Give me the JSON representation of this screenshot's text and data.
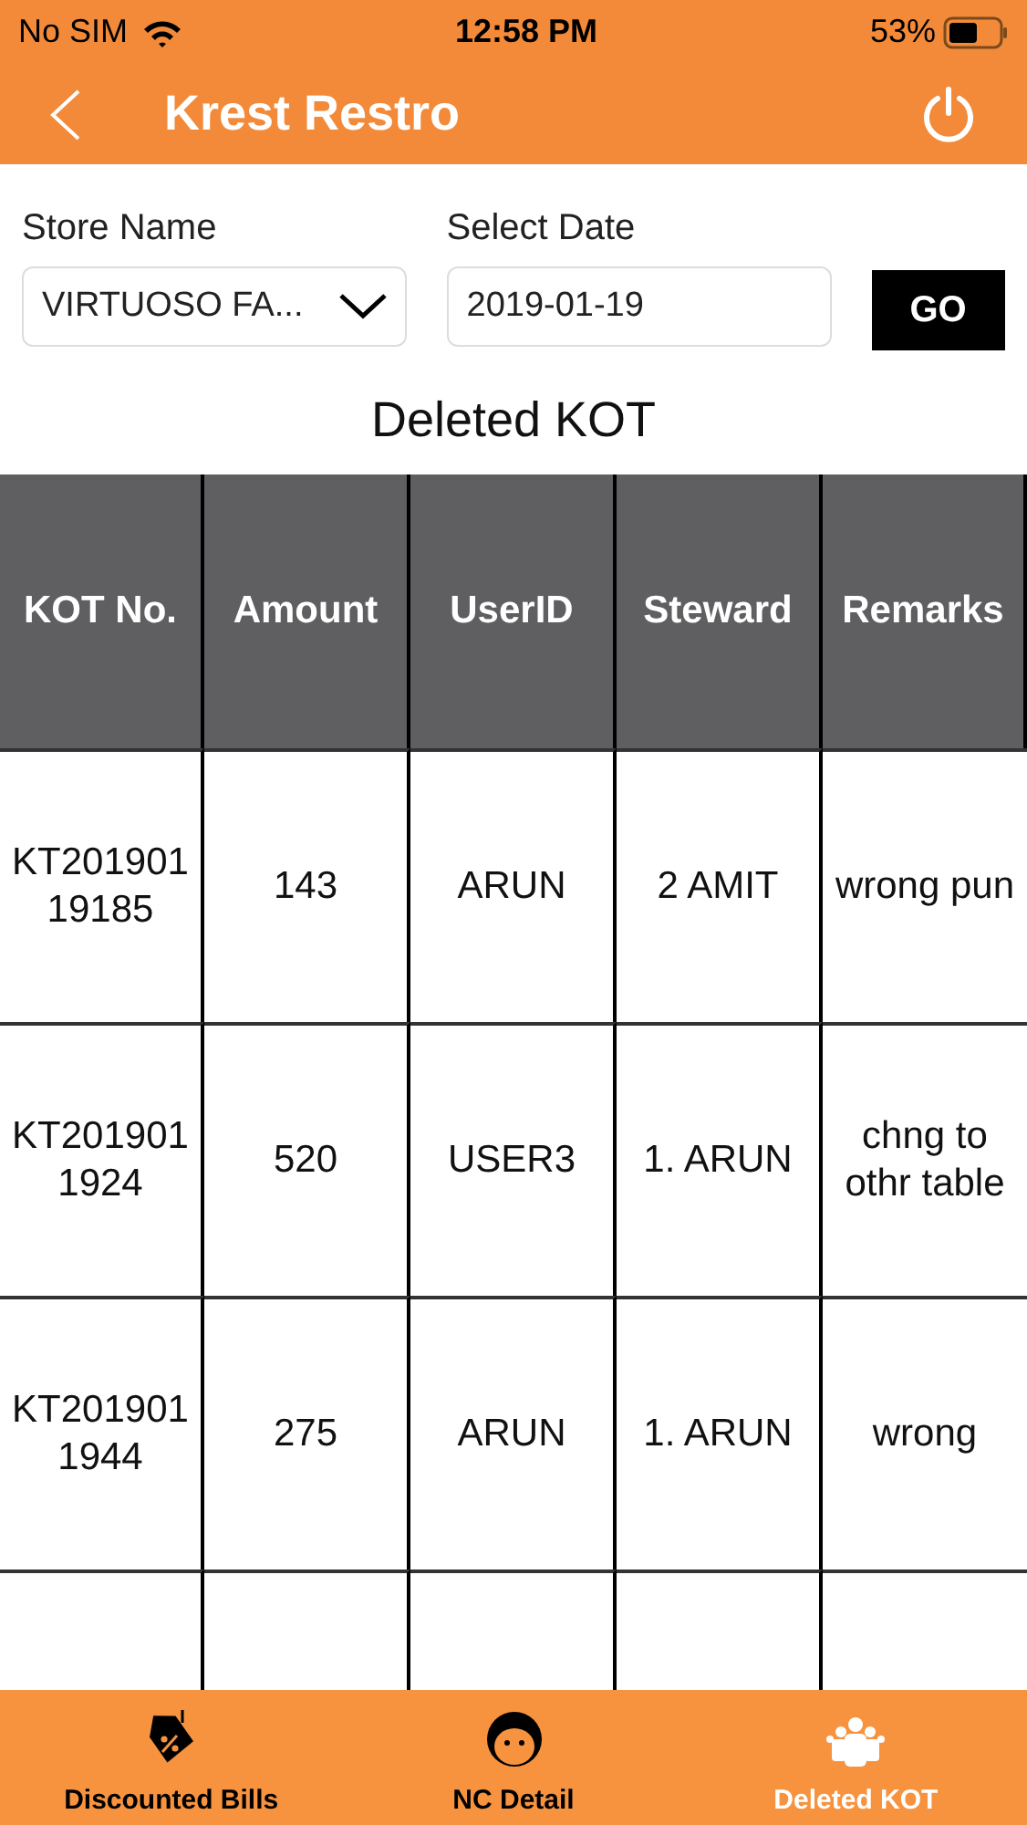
{
  "status_bar": {
    "carrier": "No SIM",
    "time": "12:58 PM",
    "battery": "53%"
  },
  "nav": {
    "title": "Krest Restro"
  },
  "filters": {
    "store_label": "Store Name",
    "store_value": "VIRTUOSO FA...",
    "date_label": "Select Date",
    "date_value": "2019-01-19",
    "go": "GO"
  },
  "section_title": "Deleted KOT",
  "table": {
    "columns": [
      "KOT No.",
      "Amount",
      "UserID",
      "Steward",
      "Remarks"
    ],
    "rows": [
      {
        "cells": [
          "KT201901 19185",
          "143",
          "ARUN",
          "2 AMIT",
          "wrong pun"
        ]
      },
      {
        "cells": [
          "KT201901 1924",
          "520",
          "USER3",
          "1. ARUN",
          "chng to othr table"
        ]
      },
      {
        "cells": [
          "KT201901 1944",
          "275",
          "ARUN",
          "1. ARUN",
          "wrong"
        ]
      }
    ]
  },
  "tabs": [
    {
      "label": "Discounted Bills",
      "kind": "tag",
      "selected": false
    },
    {
      "label": "NC Detail",
      "kind": "face",
      "selected": false
    },
    {
      "label": "Deleted KOT",
      "kind": "group",
      "selected": true
    }
  ]
}
